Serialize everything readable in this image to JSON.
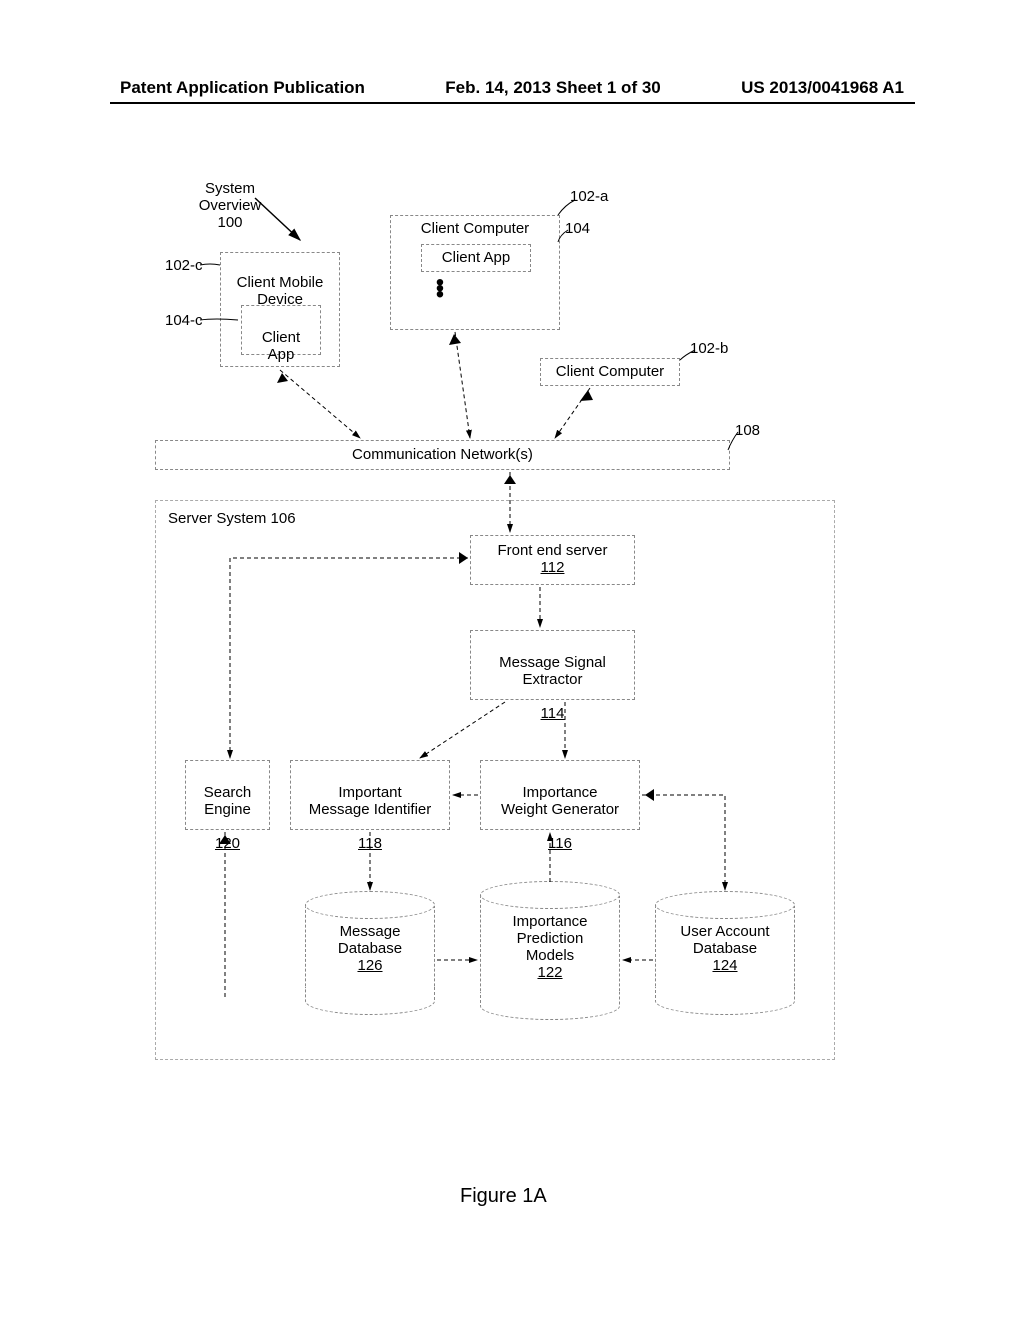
{
  "header": {
    "left": "Patent Application Publication",
    "center": "Feb. 14, 2013  Sheet 1 of 30",
    "right": "US 2013/0041968 A1"
  },
  "diagram": {
    "system_overview_label": "System\nOverview\n100",
    "refs": {
      "client_computer_a": "102-a",
      "client_computer_b": "102-b",
      "client_mobile": "102-c",
      "client_app": "104",
      "client_app_c": "104-c",
      "network": "108"
    },
    "boxes": {
      "client_mobile_device": "Client Mobile\nDevice",
      "client_app_inner": "Client\nApp",
      "client_computer_label": "Client Computer",
      "client_app_label": "Client App",
      "client_computer_b_label": "Client Computer",
      "comm_network": "Communication Network(s)",
      "server_system": "Server System 106",
      "front_end": "Front end server",
      "front_end_num": "112",
      "msg_extractor": "Message Signal\nExtractor",
      "msg_extractor_num": "114",
      "search_engine": "Search\nEngine",
      "search_engine_num": "120",
      "important_id": "Important\nMessage Identifier",
      "important_id_num": "118",
      "weight_gen": "Importance\nWeight Generator",
      "weight_gen_num": "116"
    },
    "cylinders": {
      "msg_db": "Message\nDatabase",
      "msg_db_num": "126",
      "pred_models": "Importance\nPrediction\nModels",
      "pred_models_num": "122",
      "user_db": "User Account\nDatabase",
      "user_db_num": "124"
    }
  },
  "figure_caption": "Figure 1A"
}
